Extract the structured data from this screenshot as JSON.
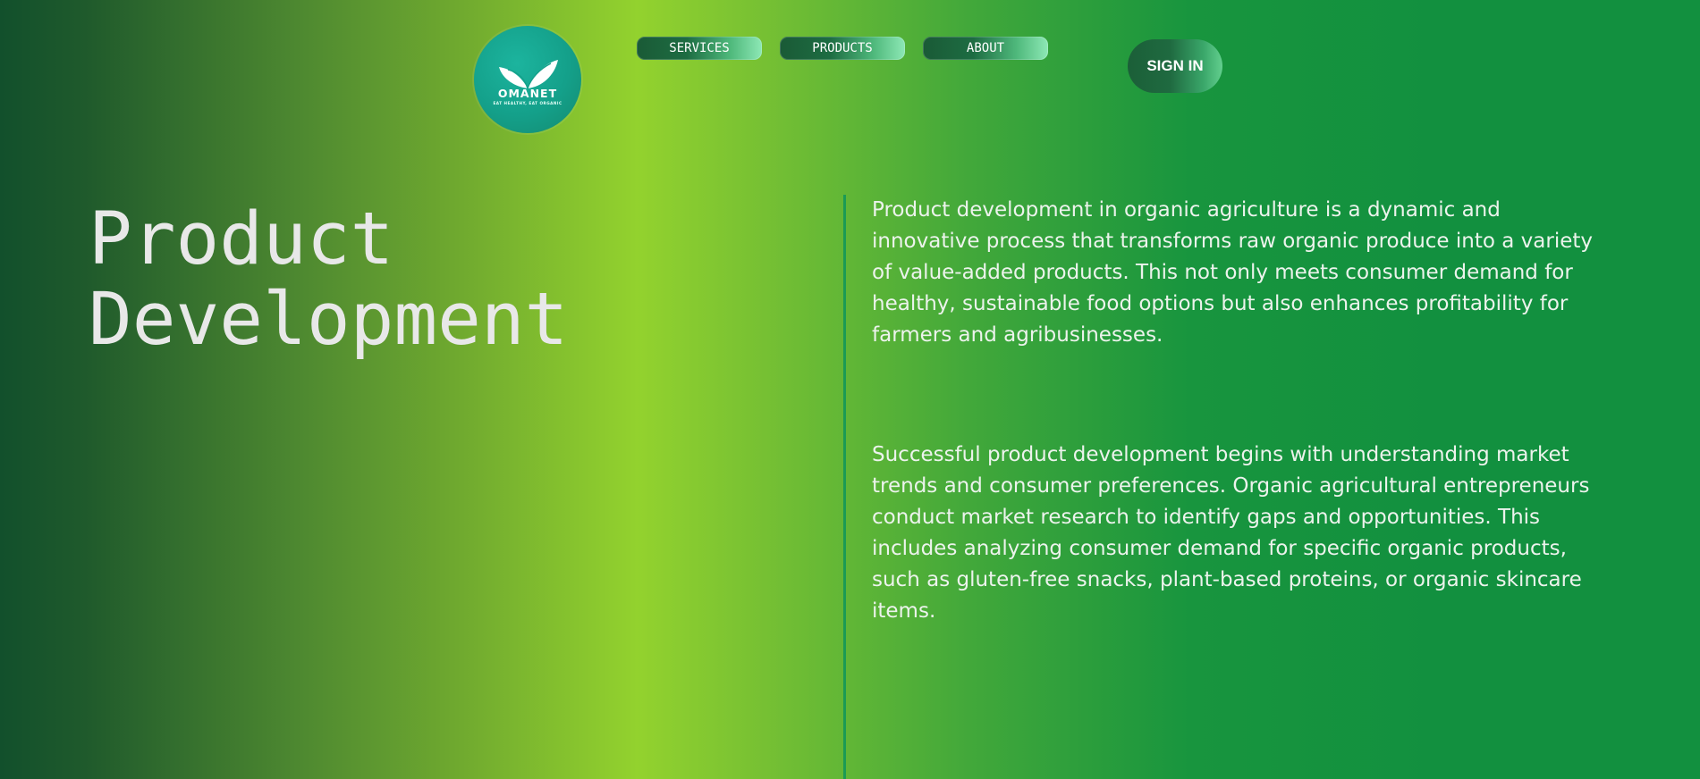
{
  "brand": {
    "name": "OMANET",
    "tagline": "EAT HEALTHY, EAT ORGANIC"
  },
  "nav": {
    "items": [
      {
        "label": "SERVICES"
      },
      {
        "label": "PRODUCTS"
      },
      {
        "label": "ABOUT"
      }
    ],
    "signin_label": "SIGN IN"
  },
  "hero": {
    "title_line1": "Product",
    "title_line2": "Development"
  },
  "content": {
    "paragraphs": [
      "Product development in organic agriculture is a dynamic and innovative process that transforms raw organic produce into a variety of value-added products. This not only meets consumer demand for healthy, sustainable food options but also enhances profitability for farmers and agribusinesses.",
      "Successful product development begins with understanding market trends and consumer preferences. Organic agricultural entrepreneurs conduct market research to identify gaps and opportunities. This includes analyzing consumer demand for specific organic products, such as gluten-free snacks, plant-based proteins, or organic skincare items."
    ]
  },
  "colors": {
    "background_left": "#12502c",
    "background_mid": "#93d22e",
    "background_right": "#12903f",
    "logo_teal": "#14a08a",
    "divider": "#1b9a55",
    "text": "#ecf3ec"
  },
  "icons": {
    "logo": "leaf-sprout-icon"
  }
}
